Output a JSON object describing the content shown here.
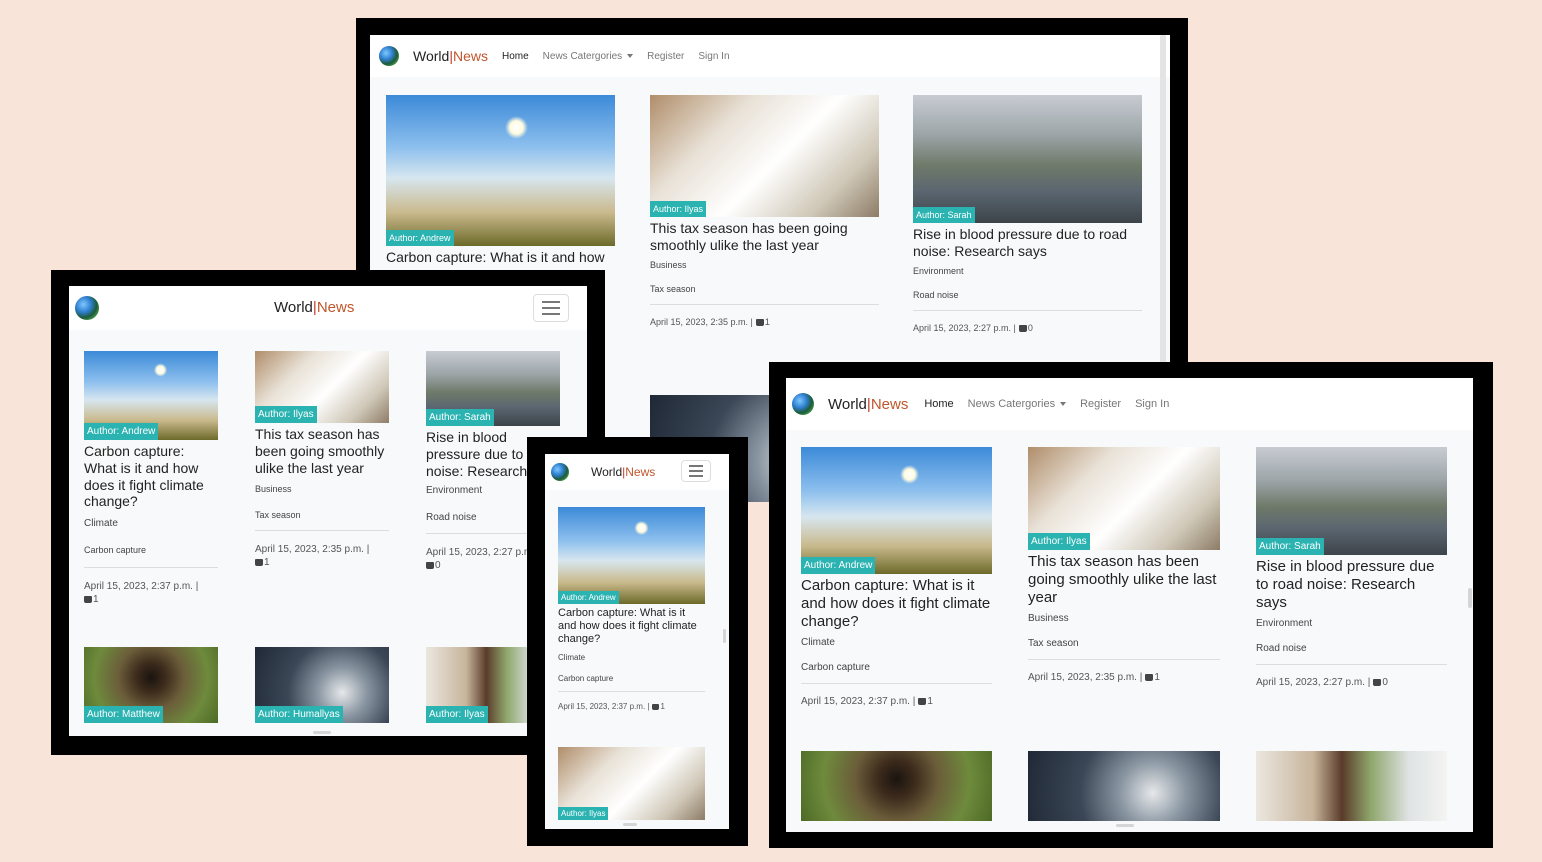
{
  "brand": {
    "world": "World",
    "sep": "|",
    "news": "News"
  },
  "nav": {
    "home": "Home",
    "categories": "News Catergories",
    "register": "Register",
    "signin": "Sign In"
  },
  "cards": [
    {
      "author": "Author: Andrew",
      "title": "Carbon capture: What is it and how does it fight climate change?",
      "category": "Climate",
      "tag": "Carbon capture",
      "date": "April 15, 2023, 2:37 p.m. |",
      "likes": "1",
      "image": "img-carbon"
    },
    {
      "author": "Author: Ilyas",
      "title": "This tax season has been going smoothly ulike the last year",
      "category": "Business",
      "tag": "Tax season",
      "date": "April 15, 2023, 2:35 p.m. |",
      "likes": "1",
      "image": "img-tax"
    },
    {
      "author": "Author: Sarah",
      "title": "Rise in blood pressure due to road noise: Research says",
      "category": "Environment",
      "tag": "Road noise",
      "date": "April 15, 2023, 2:27 p.m. |",
      "likes": "0",
      "image": "img-road"
    },
    {
      "author": "Author: Matthew",
      "image": "img-pipe"
    },
    {
      "author": "Author: Humallyas",
      "image": "img-smoke"
    },
    {
      "author": "Author: Ilyas",
      "image": "img-girl"
    }
  ],
  "devices": [
    {
      "name": "desktop-back",
      "collapsed": false
    },
    {
      "name": "tablet",
      "collapsed": true
    },
    {
      "name": "desktop-front",
      "collapsed": false
    },
    {
      "name": "phone",
      "collapsed": true
    }
  ],
  "colors": {
    "background": "#f8e4d8",
    "author_badge": "#2bb3b1",
    "brand_accent": "#c0562b"
  }
}
